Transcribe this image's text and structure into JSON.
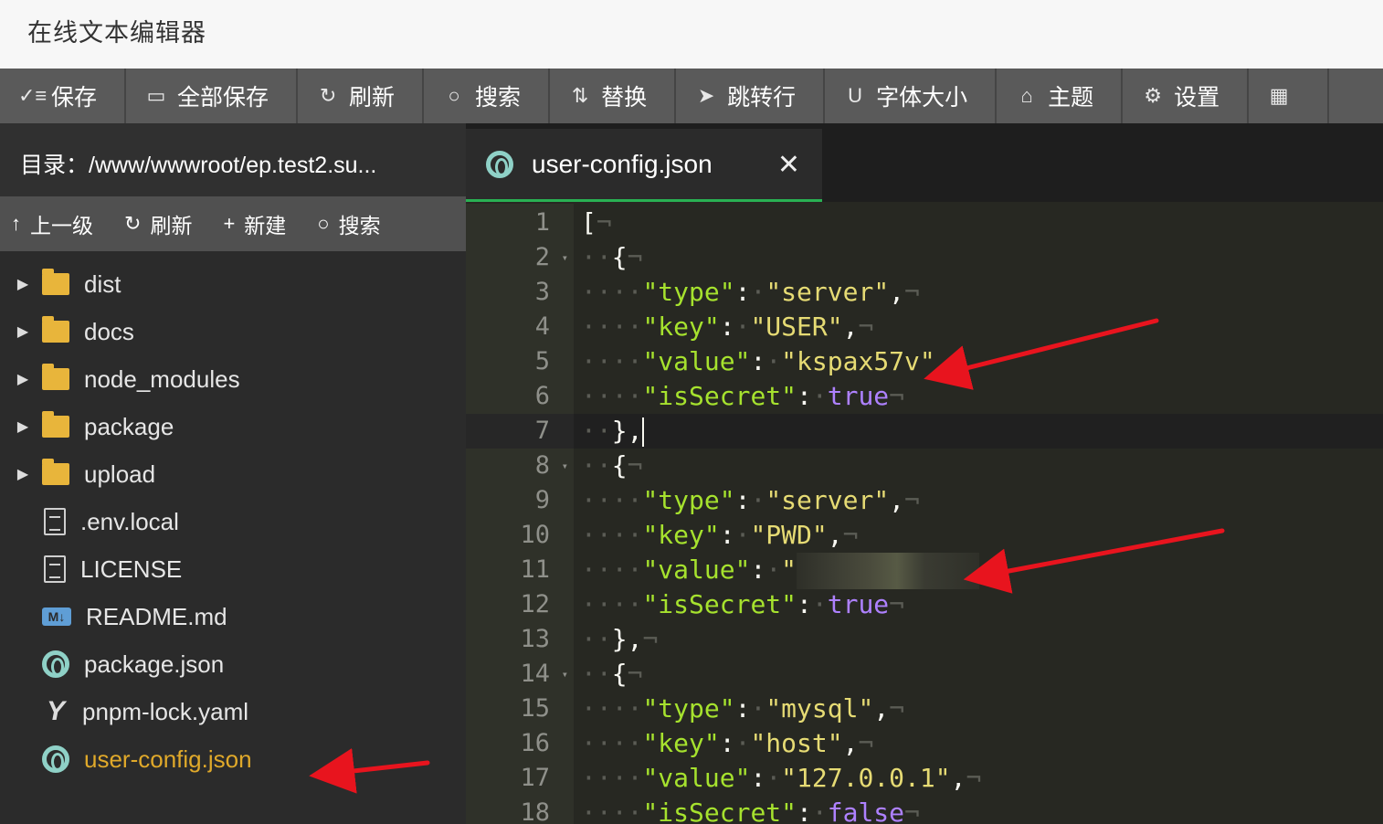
{
  "app": {
    "title": "在线文本编辑器"
  },
  "toolbar": [
    {
      "icon": "save-icon",
      "glyph": "✓≡",
      "label": "保存"
    },
    {
      "icon": "save-all-icon",
      "glyph": "▭",
      "label": "全部保存"
    },
    {
      "icon": "refresh-icon",
      "glyph": "↻",
      "label": "刷新"
    },
    {
      "icon": "search-icon",
      "glyph": "○",
      "label": "搜索"
    },
    {
      "icon": "replace-icon",
      "glyph": "⇅",
      "label": "替换"
    },
    {
      "icon": "goto-line-icon",
      "glyph": "➤",
      "label": "跳转行"
    },
    {
      "icon": "font-size-icon",
      "glyph": "U",
      "label": "字体大小"
    },
    {
      "icon": "theme-icon",
      "glyph": "⌂",
      "label": "主题"
    },
    {
      "icon": "settings-icon",
      "glyph": "⚙",
      "label": "设置"
    },
    {
      "icon": "calendar-icon",
      "glyph": "▦",
      "label": ""
    }
  ],
  "sidebar": {
    "directory": "目录：/www/wwwroot/ep.test2.su...",
    "actions": [
      {
        "icon": "arrow-up-icon",
        "glyph": "↑",
        "label": "上一级"
      },
      {
        "icon": "refresh-icon",
        "glyph": "↻",
        "label": "刷新"
      },
      {
        "icon": "plus-icon",
        "glyph": "+",
        "label": "新建"
      },
      {
        "icon": "search-icon",
        "glyph": "○",
        "label": "搜索"
      }
    ],
    "items": [
      {
        "type": "folder",
        "name": "dist"
      },
      {
        "type": "folder",
        "name": "docs"
      },
      {
        "type": "folder",
        "name": "node_modules"
      },
      {
        "type": "folder",
        "name": "package"
      },
      {
        "type": "folder",
        "name": "upload"
      },
      {
        "type": "file",
        "name": ".env.local"
      },
      {
        "type": "file",
        "name": "LICENSE"
      },
      {
        "type": "markdown",
        "name": "README.md"
      },
      {
        "type": "json",
        "name": "package.json"
      },
      {
        "type": "yaml",
        "name": "pnpm-lock.yaml"
      },
      {
        "type": "json",
        "name": "user-config.json",
        "active": true
      }
    ]
  },
  "tab": {
    "filename": "user-config.json",
    "close": "✕"
  },
  "editor": {
    "current_line": 7,
    "lines": [
      {
        "n": "1",
        "fold": false
      },
      {
        "n": "2",
        "fold": true
      },
      {
        "n": "3",
        "fold": false
      },
      {
        "n": "4",
        "fold": false
      },
      {
        "n": "5",
        "fold": false
      },
      {
        "n": "6",
        "fold": false
      },
      {
        "n": "7",
        "fold": false
      },
      {
        "n": "8",
        "fold": true
      },
      {
        "n": "9",
        "fold": false
      },
      {
        "n": "10",
        "fold": false
      },
      {
        "n": "11",
        "fold": false
      },
      {
        "n": "12",
        "fold": false
      },
      {
        "n": "13",
        "fold": false
      },
      {
        "n": "14",
        "fold": true
      },
      {
        "n": "15",
        "fold": false
      },
      {
        "n": "16",
        "fold": false
      },
      {
        "n": "17",
        "fold": false
      },
      {
        "n": "18",
        "fold": false
      }
    ],
    "tokens": {
      "open_bracket": "[",
      "open_brace": "{",
      "close_brace_comma": "},",
      "key_type": "\"type\"",
      "key_key": "\"key\"",
      "key_value": "\"value\"",
      "key_isSecret": "\"isSecret\"",
      "server": "\"server\"",
      "mysql": "\"mysql\"",
      "USER": "\"USER\"",
      "PWD": "\"PWD\"",
      "host": "\"host\"",
      "kspax57v": "\"kspax57v\"",
      "localhost": "\"127.0.0.1\"",
      "pwd_quote": "\"",
      "true": "true",
      "false": "false",
      "colon": ":",
      "comma": ",",
      "pilcrow": "¬",
      "dot": "·"
    }
  },
  "colors": {
    "accent": "#29b153",
    "arrow": "#e8141e",
    "active_file": "#e0a92a"
  }
}
